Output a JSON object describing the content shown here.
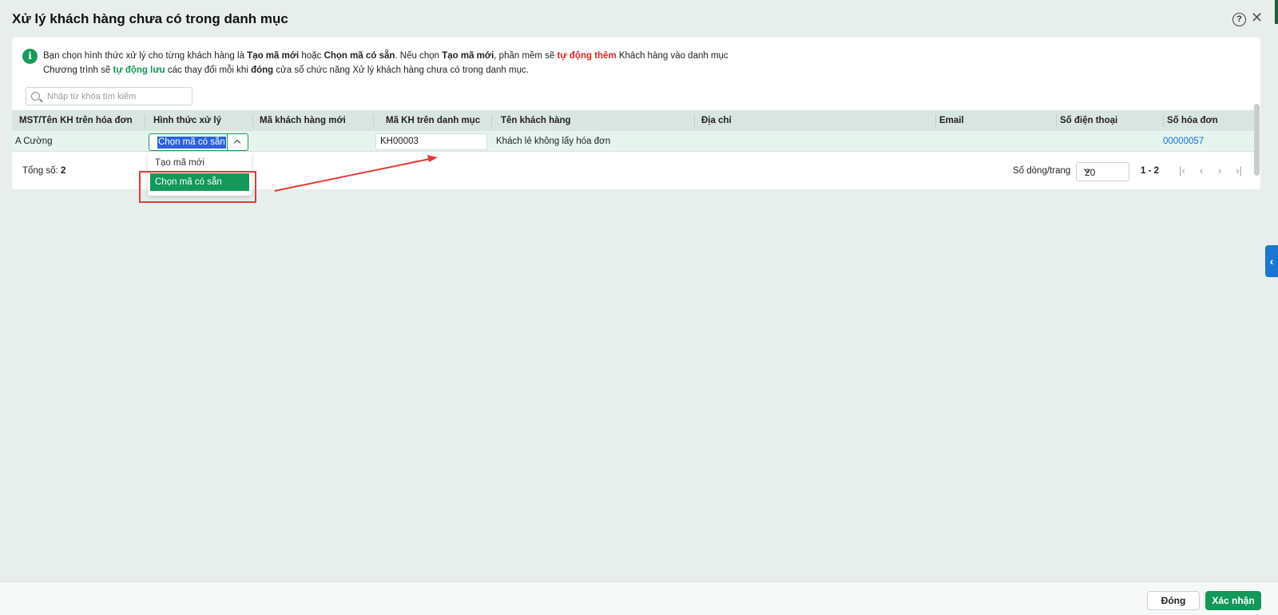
{
  "dialog": {
    "title": "Xử lý khách hàng chưa có trong danh mục",
    "help_glyph": "?",
    "close_glyph": "✕"
  },
  "info": {
    "line1": [
      {
        "text": "Bạn chọn hình thức xử lý cho từng khách hàng là ",
        "style": "normal"
      },
      {
        "text": "Tạo mã mới",
        "style": "bold"
      },
      {
        "text": " hoặc ",
        "style": "normal"
      },
      {
        "text": "Chọn mã có sẵn",
        "style": "bold"
      },
      {
        "text": ". Nếu chọn ",
        "style": "normal"
      },
      {
        "text": "Tạo mã mới",
        "style": "bold"
      },
      {
        "text": ", phần mềm sẽ ",
        "style": "normal"
      },
      {
        "text": "tự động thêm",
        "style": "red"
      },
      {
        "text": " Khách hàng vào danh mục",
        "style": "normal"
      }
    ],
    "line2": [
      {
        "text": "Chương trình sẽ ",
        "style": "normal"
      },
      {
        "text": "tự động lưu",
        "style": "green"
      },
      {
        "text": " các thay đổi mỗi khi ",
        "style": "normal"
      },
      {
        "text": "đóng",
        "style": "bold"
      },
      {
        "text": " cửa sổ chức năng Xử lý khách hàng chưa có trong danh mục.",
        "style": "normal"
      }
    ]
  },
  "search": {
    "placeholder": "Nhập từ khóa tìm kiếm",
    "value": ""
  },
  "table": {
    "columns": [
      "MST/Tên KH trên hóa đơn",
      "Hình thức xử lý",
      "Mã khách hàng mới",
      "Mã KH trên danh mục",
      "Tên khách hàng",
      "Địa chỉ",
      "Email",
      "Số điện thoại",
      "Số hóa đơn"
    ],
    "rows": [
      {
        "mst_name": "A Cường",
        "method": "Chọn mã có sẵn",
        "new_code": "",
        "catalog_code": "KH00003",
        "customer_name": "Khách lẻ không lấy hóa đơn",
        "address": "",
        "email": "",
        "phone": "",
        "invoice_no": "00000057"
      }
    ]
  },
  "dropdown": {
    "options": [
      "Tạo mã mới",
      "Chọn mã có sẵn"
    ],
    "selected_index": 1
  },
  "summary": {
    "total_label": "Tổng số:",
    "total_value": "2"
  },
  "pagination": {
    "rows_label": "Số dòng/trang",
    "rows_per_page": "20",
    "range": "1 - 2"
  },
  "footer": {
    "close_label": "Đóng",
    "confirm_label": "Xác nhận"
  },
  "colors": {
    "primary": "#13985a",
    "highlight": "#e02424",
    "link": "#1a73d9",
    "annotation": "#e53935"
  }
}
